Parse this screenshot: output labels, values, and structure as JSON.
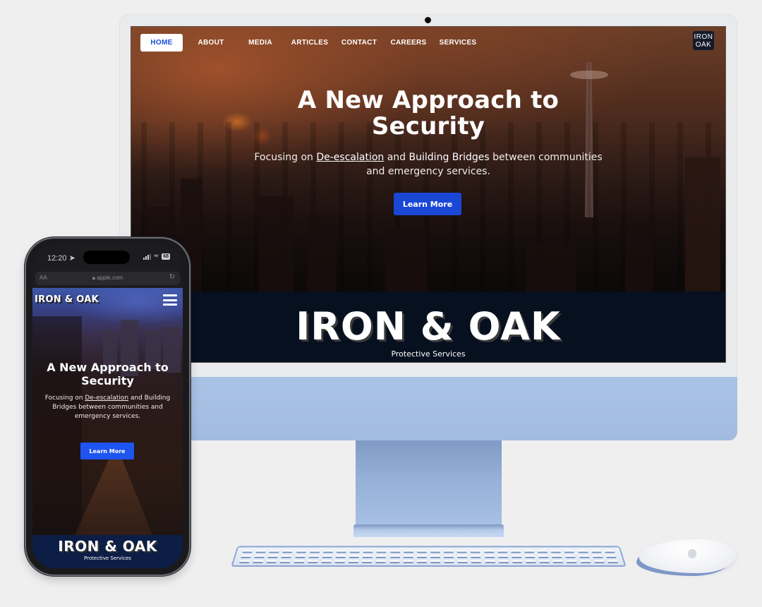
{
  "desktop": {
    "nav": {
      "items": [
        {
          "label": "HOME",
          "active": true
        },
        {
          "label": "ABOUT"
        },
        {
          "label": "MEDIA"
        },
        {
          "label": "ARTICLES"
        },
        {
          "label": "CONTACT"
        },
        {
          "label": "CAREERS"
        },
        {
          "label": "SERVICES"
        }
      ],
      "logo_line1": "IRON",
      "logo_line2": "OAK"
    },
    "hero": {
      "title_line1": "A New Approach to",
      "title_line2": "Security",
      "sub_pre": "Focusing on ",
      "sub_link": "De-escalation",
      "sub_mid": " and ",
      "sub_bold": "Building Bridges",
      "sub_post1": " between communities",
      "sub_line2": "and emergency services.",
      "cta_label": "Learn More"
    },
    "brand": {
      "title": "IRON & OAK",
      "subtitle": "Protective Services"
    }
  },
  "phone": {
    "status": {
      "time": "12:20",
      "battery": "68",
      "location_icon": "location-arrow-icon"
    },
    "browser": {
      "text_size_label": "AA",
      "url": "apple.com",
      "lock_icon": "lock-icon",
      "reload_icon": "reload-icon"
    },
    "nav": {
      "title": "IRON & OAK",
      "menu_icon": "hamburger-menu-icon"
    },
    "hero": {
      "title_line1": "A New Approach to",
      "title_line2": "Security",
      "sub_pre": "Focusing on ",
      "sub_link": "De-escalation",
      "sub_post": " and Building Bridges between communities and emergency services.",
      "cta_label": "Learn More"
    },
    "brand": {
      "title": "IRON & OAK",
      "subtitle": "Protective Services"
    }
  },
  "colors": {
    "accent_blue": "#1a47d6",
    "brand_band": "#07101f",
    "phone_band": "#0c1e45",
    "imac_blue": "#a9c3e6"
  }
}
